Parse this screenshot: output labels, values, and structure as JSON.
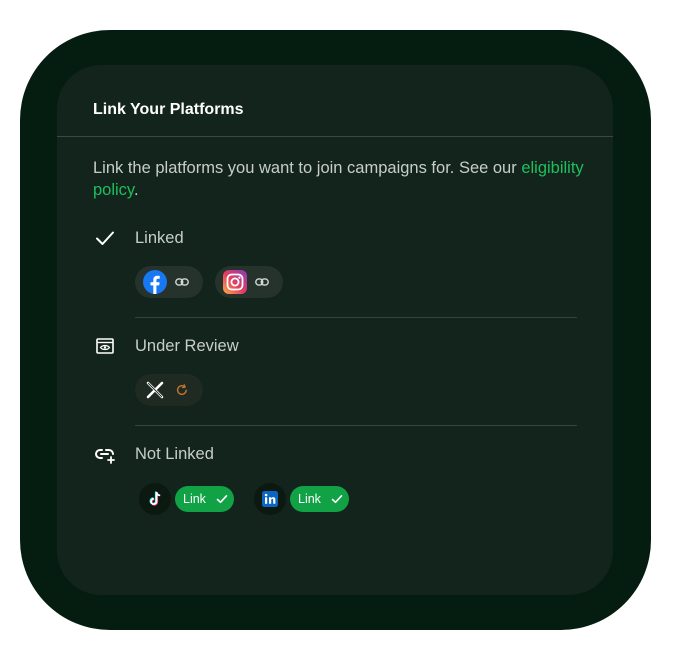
{
  "card": {
    "title": "Link Your Platforms",
    "description_prefix": "Link the platforms you want to join campaigns for. See our ",
    "description_link": "eligibility policy",
    "description_suffix": "."
  },
  "sections": {
    "linked": {
      "label": "Linked",
      "platforms": [
        "facebook",
        "instagram"
      ]
    },
    "under_review": {
      "label": "Under Review",
      "platforms": [
        "x"
      ]
    },
    "not_linked": {
      "label": "Not Linked",
      "platforms": [
        "tiktok",
        "linkedin"
      ],
      "link_label_tiktok": "Link",
      "link_label_linkedin": "Link"
    }
  },
  "colors": {
    "accent": "#1fbf5e",
    "button": "#10a245",
    "review": "#c0722e",
    "facebook": "#1877f2",
    "linkedin": "#0a66c2"
  },
  "icons": [
    "check-icon",
    "eye-icon",
    "link-plus-icon",
    "chain-link-icon",
    "refresh-icon",
    "facebook-icon",
    "instagram-icon",
    "x-icon",
    "tiktok-icon",
    "linkedin-icon"
  ]
}
